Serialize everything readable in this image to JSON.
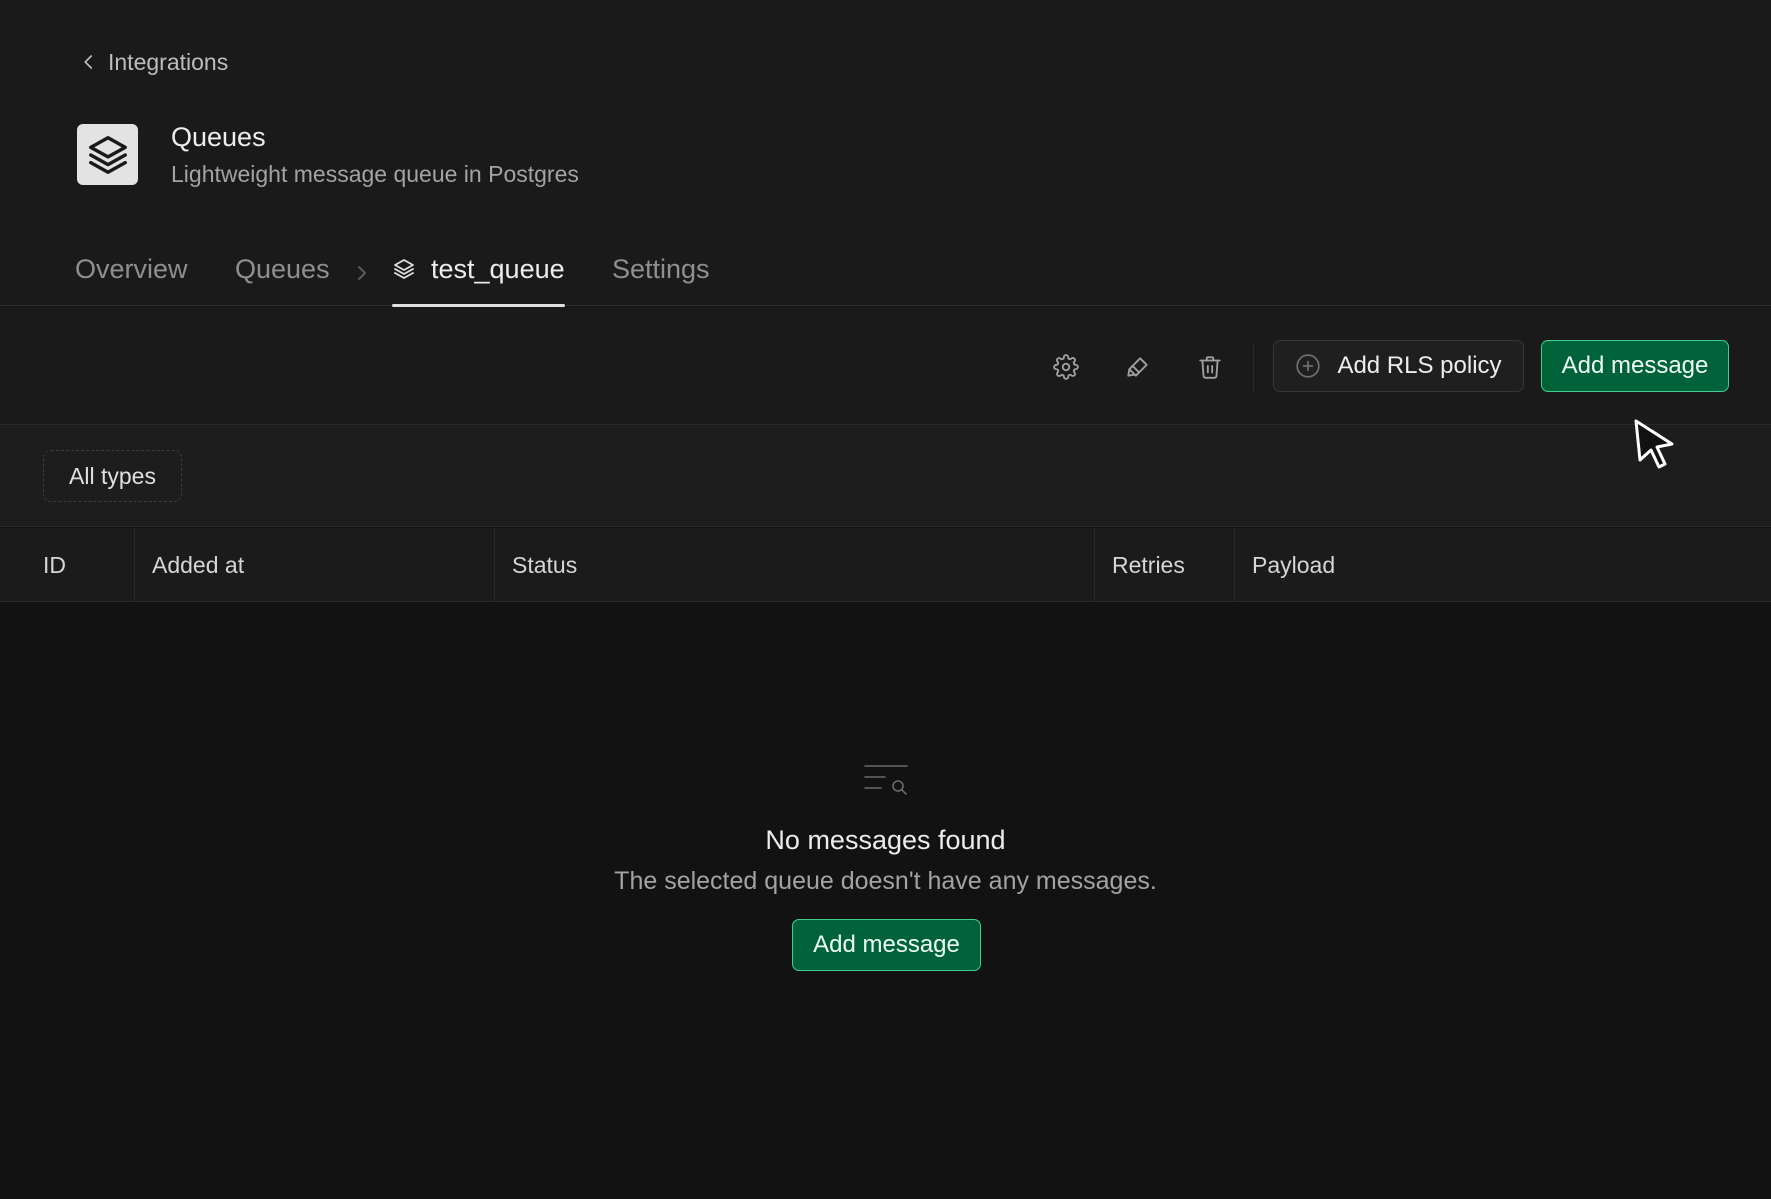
{
  "header": {
    "back_label": "Integrations",
    "app_title": "Queues",
    "app_subtitle": "Lightweight message queue in Postgres",
    "logo_icon": "layers-icon"
  },
  "tabs": [
    {
      "label": "Overview",
      "active": false
    },
    {
      "label": "Queues",
      "active": false
    },
    {
      "label": "test_queue",
      "active": true,
      "icon": "layers-icon"
    },
    {
      "label": "Settings",
      "active": false
    }
  ],
  "toolbar": {
    "icons": [
      "settings-icon",
      "paint-brush-icon",
      "trash-icon"
    ],
    "add_rls_label": "Add RLS policy",
    "add_message_label": "Add message"
  },
  "filter": {
    "label": "All types"
  },
  "table": {
    "columns": [
      "ID",
      "Added at",
      "Status",
      "Retries",
      "Payload"
    ]
  },
  "empty_state": {
    "icon": "search-list-icon",
    "title": "No messages found",
    "description": "The selected queue doesn't have any messages.",
    "button_label": "Add message"
  },
  "colors": {
    "accent": "#006239",
    "accent_border": "#3ecf8e",
    "background": "#121212",
    "panel": "#1a1a1a"
  }
}
